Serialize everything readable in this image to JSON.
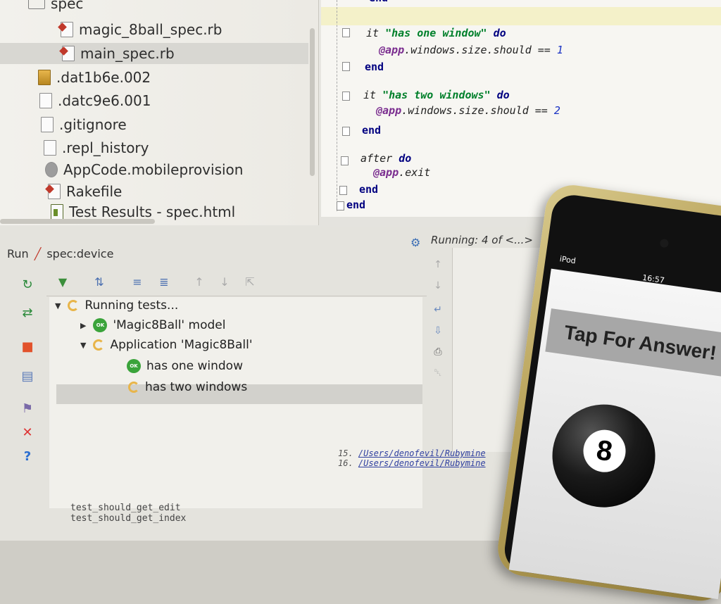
{
  "project_tree": {
    "items": [
      {
        "label": "spec",
        "icon": "folder-icon"
      },
      {
        "label": "magic_8ball_spec.rb",
        "icon": "ruby-file-icon"
      },
      {
        "label": "main_spec.rb",
        "icon": "ruby-file-icon",
        "selected": true
      },
      {
        "label": ".dat1b6e.002",
        "icon": "data-file-icon"
      },
      {
        "label": ".datc9e6.001",
        "icon": "text-file-icon"
      },
      {
        "label": ".gitignore",
        "icon": "text-file-icon"
      },
      {
        "label": ".repl_history",
        "icon": "text-file-icon"
      },
      {
        "label": "AppCode.mobileprovision",
        "icon": "gear-file-icon"
      },
      {
        "label": "Rakefile",
        "icon": "ruby-file-icon"
      },
      {
        "label": "Test Results - spec.html",
        "icon": "html-file-icon"
      }
    ]
  },
  "editor": {
    "lines": {
      "l0": "end",
      "l1_kw": "it",
      "l1_str": "\"has one window\"",
      "l1_do": "do",
      "l2_ivar": "@app",
      "l2_rest": ".windows.size.should == ",
      "l2_num": "1",
      "l3": "end",
      "l4_kw": "it",
      "l4_str": "\"has two windows\"",
      "l4_do": "do",
      "l5_ivar": "@app",
      "l5_rest": ".windows.size.should == ",
      "l5_num": "2",
      "l6": "end",
      "l7_kw": "after",
      "l7_do": "do",
      "l8_ivar": "@app",
      "l8_rest": ".exit",
      "l9": "end",
      "l10": "end"
    }
  },
  "run_panel": {
    "run_label": "Run",
    "config_name": "spec:device",
    "status": "Running: 4 of <...>",
    "tests": [
      {
        "label": "Running tests...",
        "state": "running"
      },
      {
        "label": "'Magic8Ball' model",
        "state": "ok"
      },
      {
        "label": "Application 'Magic8Ball'",
        "state": "running"
      },
      {
        "label": "has one window",
        "state": "ok"
      },
      {
        "label": "has two windows",
        "state": "running"
      }
    ],
    "ok_badge": "OK",
    "log_lines": [
      {
        "num": "15.",
        "path": "/Users/denofevil/Rubymine"
      },
      {
        "num": "16.",
        "path": "/Users/denofevil/Rubymine"
      }
    ],
    "bottom_names": [
      "test_should_get_edit",
      "test_should_get_index"
    ]
  },
  "phone": {
    "carrier": "iPod",
    "time": "16:57",
    "button_label": "Tap For Answer!",
    "ball_number": "8"
  }
}
